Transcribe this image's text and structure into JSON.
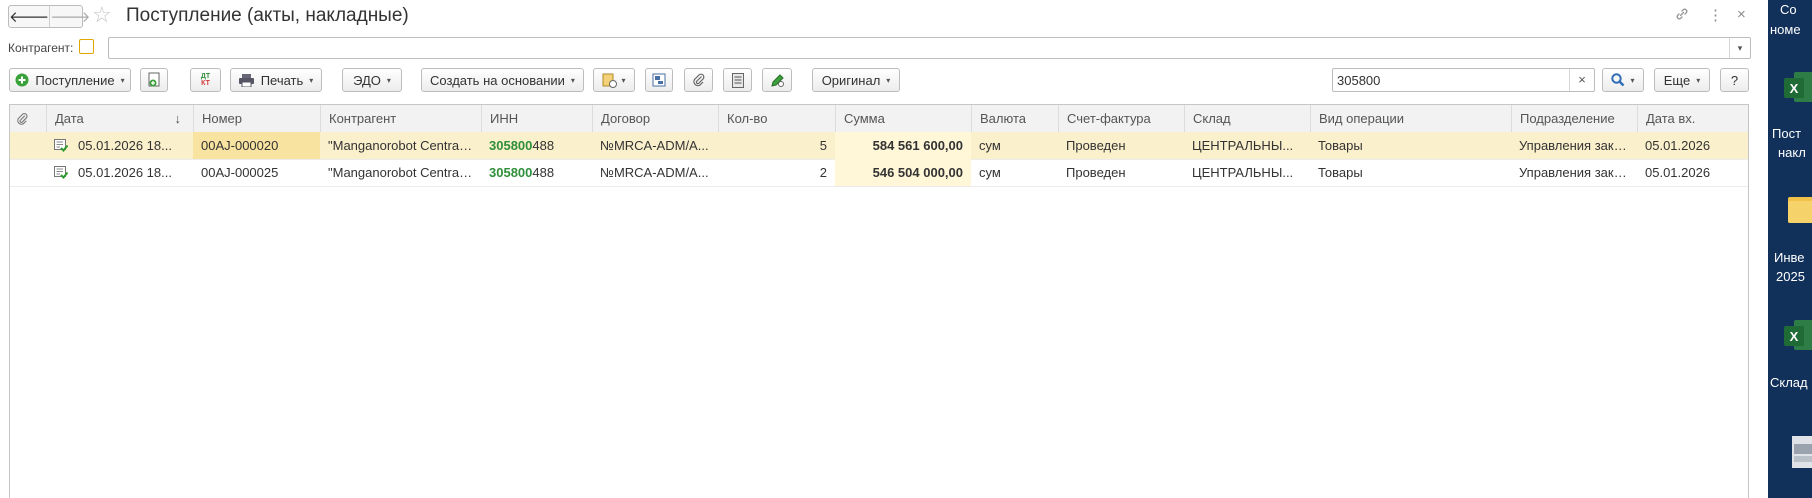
{
  "window": {
    "title": "Поступление (акты, накладные)",
    "nav_back": "🡐",
    "nav_forward": "🡒",
    "link_icon": "link-icon",
    "more_icon": "⋮",
    "close_icon": "×"
  },
  "filter": {
    "contragent_label": "Контрагент:",
    "contragent_value": ""
  },
  "toolbar": {
    "postuplenie": "Поступление",
    "print": "Печать",
    "edo": "ЭДО",
    "create_based": "Создать на основании",
    "original": "Оригинал",
    "more": "Еще",
    "help": "?",
    "dtkt_top": "ДТ",
    "dtkt_bottom": "КТ"
  },
  "search": {
    "value": "305800",
    "clear": "×"
  },
  "table": {
    "columns": [
      "Дата",
      "Номер",
      "Контрагент",
      "ИНН",
      "Договор",
      "Кол-во",
      "Сумма",
      "Валюта",
      "Счет-фактура",
      "Склад",
      "Вид операции",
      "Подразделение",
      "Дата вх."
    ],
    "sort_indicator": "↓",
    "rows": [
      {
        "date": "05.01.2026 18...",
        "number": "00AJ-000020",
        "contragent": "\"Manganorobot Central ...",
        "inn_match": "305800",
        "inn_rest": "488",
        "contract": "№MRCA-ADM/A...",
        "qty": "5",
        "sum": "584 561 600,00",
        "currency": "сум",
        "invoice": "Проведен",
        "warehouse": "ЦЕНТРАЛЬНЫ...",
        "operation": "Товары",
        "department": "Управления заку...",
        "date_in": "05.01.2026"
      },
      {
        "date": "05.01.2026 18...",
        "number": "00AJ-000025",
        "contragent": "\"Manganorobot Central ...",
        "inn_match": "305800",
        "inn_rest": "488",
        "contract": "№MRCA-ADM/A...",
        "qty": "2",
        "sum": "546 504 000,00",
        "currency": "сум",
        "invoice": "Проведен",
        "warehouse": "ЦЕНТРАЛЬНЫ...",
        "operation": "Товары",
        "department": "Управления заку...",
        "date_in": "05.01.2026"
      }
    ]
  },
  "desktop": {
    "items": [
      {
        "line1": "Со",
        "line2": "номе"
      },
      {
        "line1": "Пост",
        "line2": "накл"
      },
      {
        "line1": "Инве",
        "line2": "2025"
      },
      {
        "line1": "Склад",
        "line2": ""
      }
    ]
  },
  "colors": {
    "accent_green": "#2f8f3a",
    "selected_row": "#fbf0cc",
    "desktop_bg": "#11305a"
  }
}
